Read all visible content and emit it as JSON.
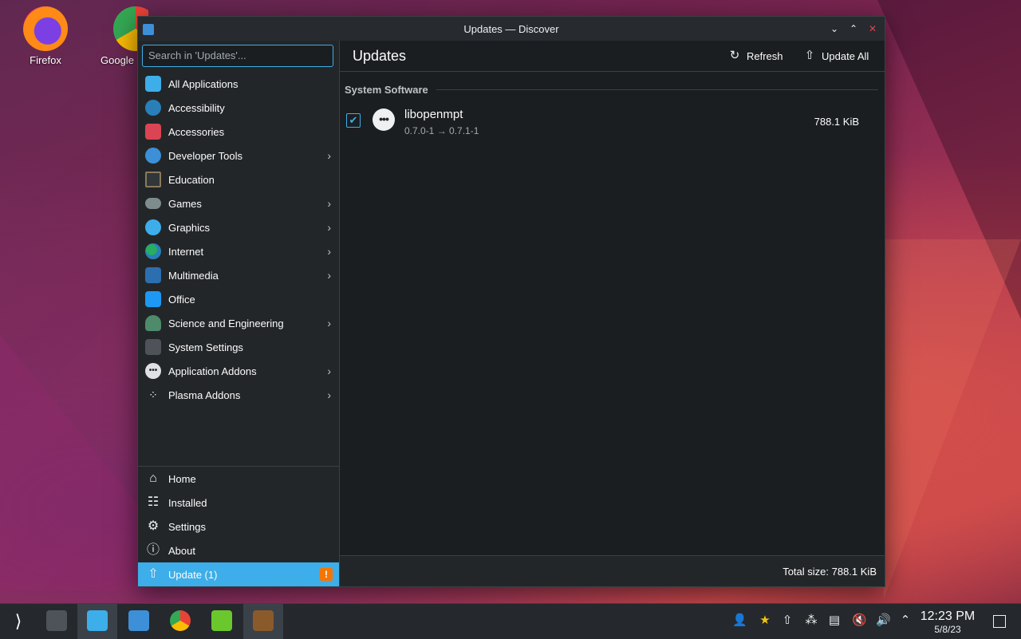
{
  "desktop": {
    "icons": [
      {
        "label": "Firefox"
      },
      {
        "label": "Google"
      }
    ]
  },
  "window": {
    "title": "Updates — Discover",
    "search_placeholder": "Search in 'Updates'...",
    "page_title": "Updates",
    "toolbar": {
      "refresh_label": "Refresh",
      "update_all_label": "Update All"
    },
    "categories": [
      {
        "label": "All Applications",
        "icon": "grid-icon",
        "color": "#3daee9",
        "has_children": false
      },
      {
        "label": "Accessibility",
        "icon": "accessibility-icon",
        "color": "#2980b9",
        "has_children": false
      },
      {
        "label": "Accessories",
        "icon": "toolbox-icon",
        "color": "#da4453",
        "has_children": false
      },
      {
        "label": "Developer Tools",
        "icon": "developer-icon",
        "color": "#3d8fd8",
        "has_children": true
      },
      {
        "label": "Education",
        "icon": "chalkboard-icon",
        "color": "#31363b",
        "has_children": false
      },
      {
        "label": "Games",
        "icon": "gamepad-icon",
        "color": "#7f8c8d",
        "has_children": true
      },
      {
        "label": "Graphics",
        "icon": "graphics-icon",
        "color": "#3daee9",
        "has_children": true
      },
      {
        "label": "Internet",
        "icon": "globe-icon",
        "color": "#27ae60",
        "has_children": true
      },
      {
        "label": "Multimedia",
        "icon": "multimedia-icon",
        "color": "#2c6fb0",
        "has_children": true
      },
      {
        "label": "Office",
        "icon": "office-icon",
        "color": "#1d99f3",
        "has_children": false
      },
      {
        "label": "Science and Engineering",
        "icon": "flask-icon",
        "color": "#4d8b6b",
        "has_children": true
      },
      {
        "label": "System Settings",
        "icon": "settings-panel-icon",
        "color": "#4d5359",
        "has_children": false
      },
      {
        "label": "Application Addons",
        "icon": "addons-icon",
        "color": "#dfe1e3",
        "has_children": true
      },
      {
        "label": "Plasma Addons",
        "icon": "plasma-icon",
        "color": "#eff0f1",
        "has_children": true
      }
    ],
    "nav": [
      {
        "label": "Home",
        "icon": "home-icon",
        "glyph": "⌂"
      },
      {
        "label": "Installed",
        "icon": "installed-icon",
        "glyph": "☷"
      },
      {
        "label": "Settings",
        "icon": "sliders-icon",
        "glyph": "⚙"
      },
      {
        "label": "About",
        "icon": "info-icon",
        "glyph": "ⓘ"
      }
    ],
    "update_nav": {
      "label": "Update (1)",
      "badge": "!"
    },
    "section": {
      "title": "System Software"
    },
    "updates": [
      {
        "name": "libopenmpt",
        "version": "0.7.0-1 → 0.7.1-1",
        "size": "788.1 KiB",
        "checked": true,
        "icon_glyph": "•••"
      }
    ],
    "footer": {
      "total": "Total size: 788.1 KiB"
    }
  },
  "taskbar": {
    "clock": {
      "time": "12:23 PM",
      "date": "5/8/23"
    }
  },
  "colors": {
    "accent": "#3daee9",
    "warning": "#f67400",
    "window_bg": "#1b1e20",
    "sidebar_bg": "#232629"
  }
}
